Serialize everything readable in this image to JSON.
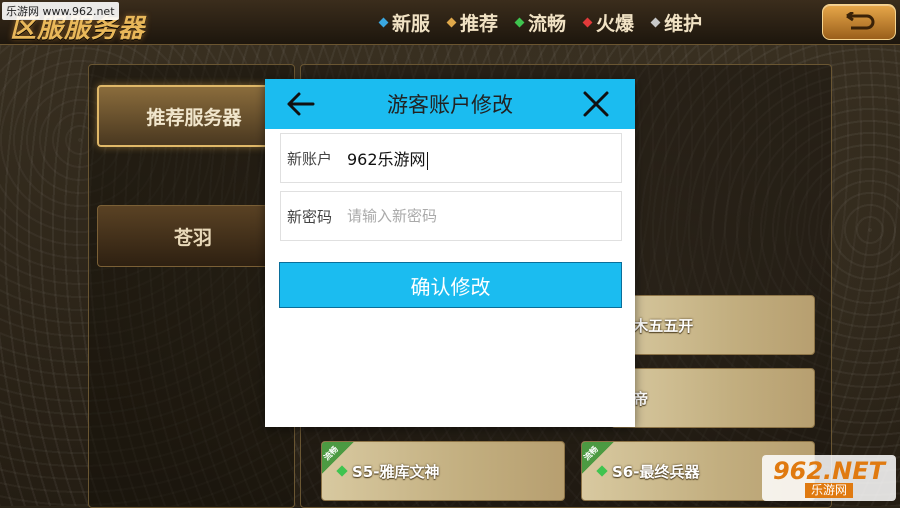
{
  "watermark_top_left": "乐游网 www.962.net",
  "app_title": "区服服务器",
  "legend": [
    {
      "label": "新服",
      "color": "#3aa7e0"
    },
    {
      "label": "推荐",
      "color": "#e0a84a"
    },
    {
      "label": "流畅",
      "color": "#3fc44f"
    },
    {
      "label": "火爆",
      "color": "#e23a3a"
    },
    {
      "label": "维护",
      "color": "#c8c8c8"
    }
  ],
  "left_panel": {
    "categories": [
      {
        "label": "推荐服务器",
        "active": true
      },
      {
        "label": "苍羽",
        "active": false
      }
    ]
  },
  "servers": [
    {
      "label": "-旗木五五开",
      "tag": ""
    },
    {
      "label": "-炎帝",
      "tag": ""
    },
    {
      "label": "S5-雅库文神",
      "tag": "流畅"
    },
    {
      "label": "S6-最终兵器",
      "tag": "流畅"
    }
  ],
  "modal": {
    "title": "游客账户修改",
    "account_label": "新账户",
    "account_value": "962乐游网",
    "password_label": "新密码",
    "password_placeholder": "请输入新密码",
    "confirm_label": "确认修改"
  },
  "watermark_bottom_right": {
    "big": "962.NET",
    "small": "乐游网"
  }
}
